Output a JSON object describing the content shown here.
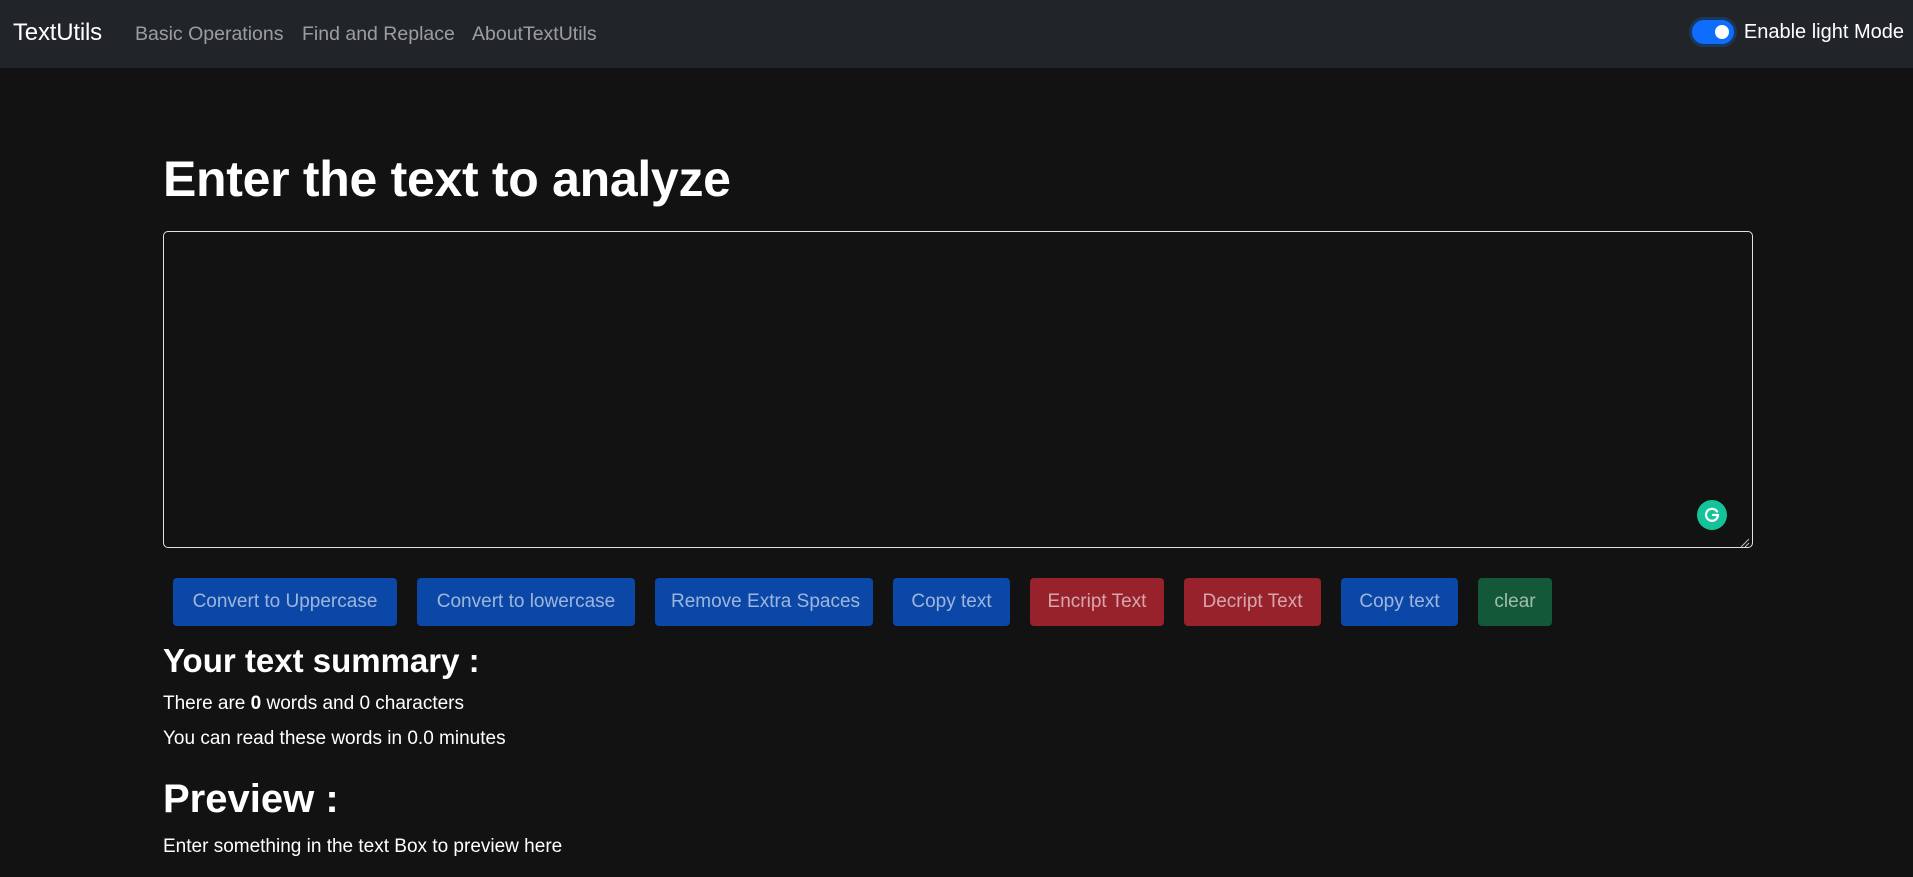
{
  "navbar": {
    "brand": "TextUtils",
    "links": [
      "Basic Operations",
      "Find and Replace",
      "AboutTextUtils"
    ],
    "toggle_label": "Enable light Mode",
    "toggle_on": true
  },
  "main": {
    "heading": "Enter the text to analyze",
    "textarea_value": "",
    "buttons": [
      {
        "label": "Convert to Uppercase",
        "variant": "primary"
      },
      {
        "label": "Convert to lowercase",
        "variant": "primary"
      },
      {
        "label": "Remove Extra Spaces",
        "variant": "primary"
      },
      {
        "label": "Copy text",
        "variant": "primary"
      },
      {
        "label": "Encript Text",
        "variant": "danger"
      },
      {
        "label": "Decript Text",
        "variant": "danger"
      },
      {
        "label": "Copy text",
        "variant": "primary"
      },
      {
        "label": "clear",
        "variant": "success"
      }
    ]
  },
  "summary": {
    "heading": "Your text summary :",
    "words_prefix": "There are ",
    "word_count": "0",
    "words_suffix": " words and 0 characters",
    "read_time": "You can read these words in 0.0 minutes"
  },
  "preview": {
    "heading": "Preview :",
    "text": "Enter something in the text Box to preview here"
  },
  "colors": {
    "background": "#121212",
    "navbar": "#212529",
    "primary": "#0b47a7",
    "danger": "#98222c",
    "success": "#135838",
    "toggle": "#0d6efd",
    "grammarly": "#15c39a"
  },
  "icons": {
    "grammarly": "grammarly-g-icon",
    "resize": "resize-grip-icon"
  }
}
